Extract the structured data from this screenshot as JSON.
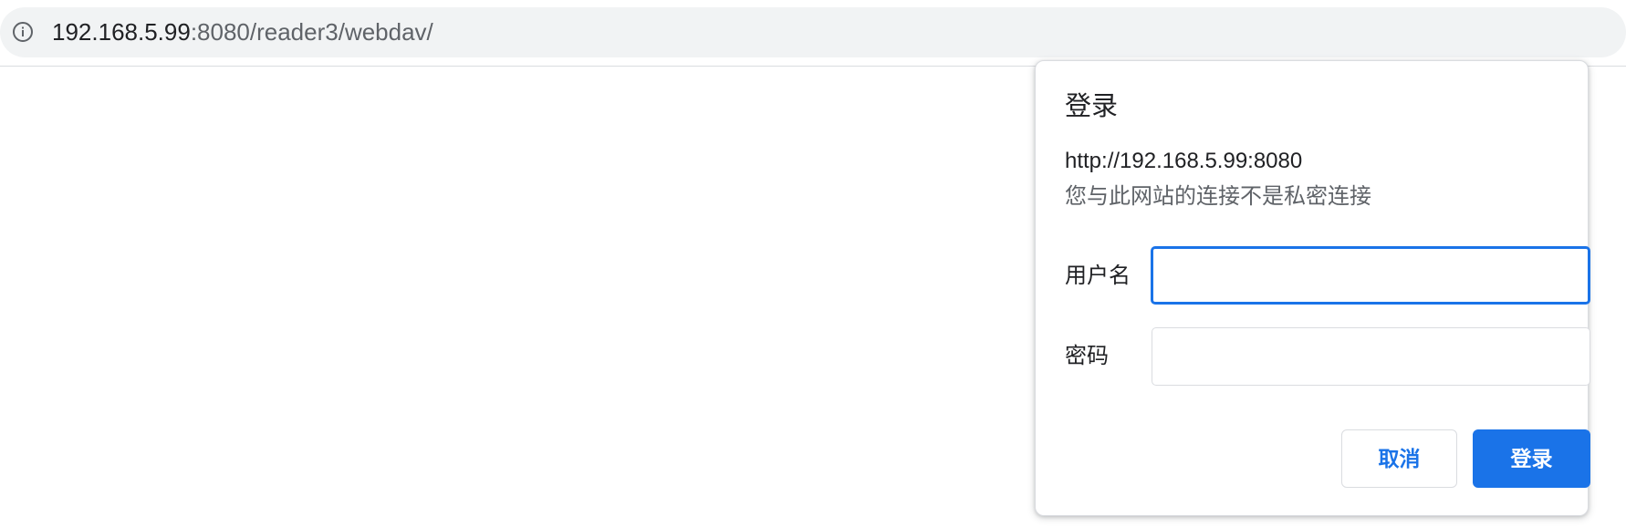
{
  "address_bar": {
    "url_host": "192.168.5.99",
    "url_rest": ":8080/reader3/webdav/",
    "icon": "info-icon"
  },
  "auth_dialog": {
    "title": "登录",
    "origin": "http://192.168.5.99:8080",
    "warning": "您与此网站的连接不是私密连接",
    "username_label": "用户名",
    "username_value": "",
    "password_label": "密码",
    "password_value": "",
    "cancel_label": "取消",
    "login_label": "登录"
  },
  "colors": {
    "accent": "#1a73e8",
    "omnibox_bg": "#f1f3f4",
    "text_primary": "#202124",
    "text_secondary": "#5f6368"
  }
}
